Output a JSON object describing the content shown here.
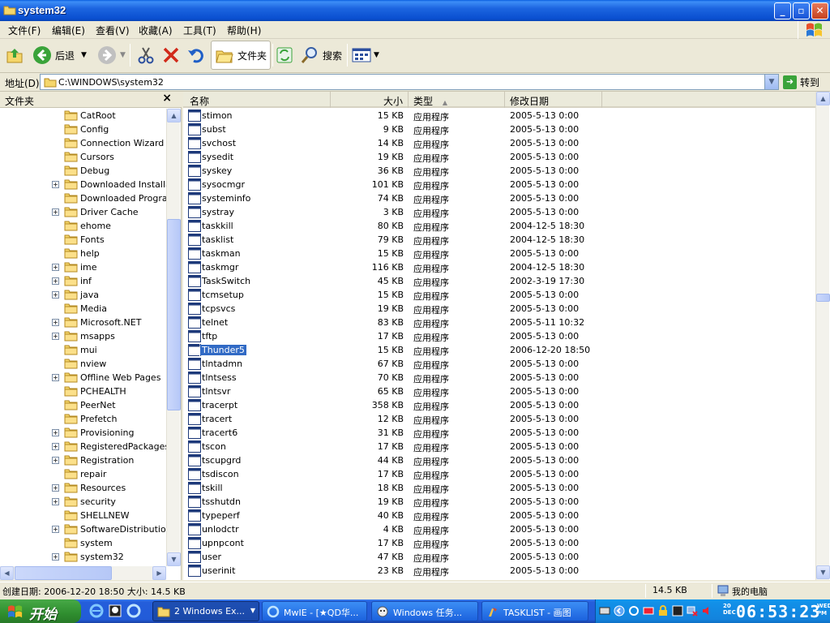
{
  "window": {
    "title": "system32"
  },
  "menu": [
    "文件(F)",
    "编辑(E)",
    "查看(V)",
    "收藏(A)",
    "工具(T)",
    "帮助(H)"
  ],
  "toolbar": {
    "back": "后退",
    "folders": "文件夹",
    "search": "搜索"
  },
  "address": {
    "label": "地址(D)",
    "value": "C:\\WINDOWS\\system32",
    "go": "转到"
  },
  "folder_pane": {
    "title": "文件夹",
    "close": "×",
    "items": [
      {
        "label": "CatRoot",
        "expandable": false
      },
      {
        "label": "Config",
        "expandable": false
      },
      {
        "label": "Connection Wizard",
        "expandable": false
      },
      {
        "label": "Cursors",
        "expandable": false
      },
      {
        "label": "Debug",
        "expandable": false
      },
      {
        "label": "Downloaded Installatio",
        "expandable": true
      },
      {
        "label": "Downloaded Program",
        "expandable": false
      },
      {
        "label": "Driver Cache",
        "expandable": true
      },
      {
        "label": "ehome",
        "expandable": false
      },
      {
        "label": "Fonts",
        "expandable": false
      },
      {
        "label": "help",
        "expandable": false
      },
      {
        "label": "ime",
        "expandable": true
      },
      {
        "label": "inf",
        "expandable": true
      },
      {
        "label": "java",
        "expandable": true
      },
      {
        "label": "Media",
        "expandable": false
      },
      {
        "label": "Microsoft.NET",
        "expandable": true
      },
      {
        "label": "msapps",
        "expandable": true
      },
      {
        "label": "mui",
        "expandable": false
      },
      {
        "label": "nview",
        "expandable": false
      },
      {
        "label": "Offline Web Pages",
        "expandable": true
      },
      {
        "label": "PCHEALTH",
        "expandable": false
      },
      {
        "label": "PeerNet",
        "expandable": false
      },
      {
        "label": "Prefetch",
        "expandable": false
      },
      {
        "label": "Provisioning",
        "expandable": true
      },
      {
        "label": "RegisteredPackages",
        "expandable": true
      },
      {
        "label": "Registration",
        "expandable": true
      },
      {
        "label": "repair",
        "expandable": false
      },
      {
        "label": "Resources",
        "expandable": true
      },
      {
        "label": "security",
        "expandable": true
      },
      {
        "label": "SHELLNEW",
        "expandable": false
      },
      {
        "label": "SoftwareDistribution",
        "expandable": true
      },
      {
        "label": "system",
        "expandable": false
      },
      {
        "label": "system32",
        "expandable": true
      }
    ]
  },
  "columns": {
    "name": "名称",
    "size": "大小",
    "type": "类型",
    "modified": "修改日期"
  },
  "files": [
    {
      "name": "stimon",
      "size": "15 KB",
      "type": "应用程序",
      "modified": "2005-5-13 0:00"
    },
    {
      "name": "subst",
      "size": "9 KB",
      "type": "应用程序",
      "modified": "2005-5-13 0:00"
    },
    {
      "name": "svchost",
      "size": "14 KB",
      "type": "应用程序",
      "modified": "2005-5-13 0:00"
    },
    {
      "name": "sysedit",
      "size": "19 KB",
      "type": "应用程序",
      "modified": "2005-5-13 0:00"
    },
    {
      "name": "syskey",
      "size": "36 KB",
      "type": "应用程序",
      "modified": "2005-5-13 0:00"
    },
    {
      "name": "sysocmgr",
      "size": "101 KB",
      "type": "应用程序",
      "modified": "2005-5-13 0:00"
    },
    {
      "name": "systeminfo",
      "size": "74 KB",
      "type": "应用程序",
      "modified": "2005-5-13 0:00"
    },
    {
      "name": "systray",
      "size": "3 KB",
      "type": "应用程序",
      "modified": "2005-5-13 0:00"
    },
    {
      "name": "taskkill",
      "size": "80 KB",
      "type": "应用程序",
      "modified": "2004-12-5 18:30"
    },
    {
      "name": "tasklist",
      "size": "79 KB",
      "type": "应用程序",
      "modified": "2004-12-5 18:30"
    },
    {
      "name": "taskman",
      "size": "15 KB",
      "type": "应用程序",
      "modified": "2005-5-13 0:00"
    },
    {
      "name": "taskmgr",
      "size": "116 KB",
      "type": "应用程序",
      "modified": "2004-12-5 18:30"
    },
    {
      "name": "TaskSwitch",
      "size": "45 KB",
      "type": "应用程序",
      "modified": "2002-3-19 17:30"
    },
    {
      "name": "tcmsetup",
      "size": "15 KB",
      "type": "应用程序",
      "modified": "2005-5-13 0:00"
    },
    {
      "name": "tcpsvcs",
      "size": "19 KB",
      "type": "应用程序",
      "modified": "2005-5-13 0:00"
    },
    {
      "name": "telnet",
      "size": "83 KB",
      "type": "应用程序",
      "modified": "2005-5-11 10:32"
    },
    {
      "name": "tftp",
      "size": "17 KB",
      "type": "应用程序",
      "modified": "2005-5-13 0:00"
    },
    {
      "name": "Thunder5",
      "size": "15 KB",
      "type": "应用程序",
      "modified": "2006-12-20 18:50",
      "selected": true
    },
    {
      "name": "tlntadmn",
      "size": "67 KB",
      "type": "应用程序",
      "modified": "2005-5-13 0:00"
    },
    {
      "name": "tlntsess",
      "size": "70 KB",
      "type": "应用程序",
      "modified": "2005-5-13 0:00"
    },
    {
      "name": "tlntsvr",
      "size": "65 KB",
      "type": "应用程序",
      "modified": "2005-5-13 0:00"
    },
    {
      "name": "tracerpt",
      "size": "358 KB",
      "type": "应用程序",
      "modified": "2005-5-13 0:00"
    },
    {
      "name": "tracert",
      "size": "12 KB",
      "type": "应用程序",
      "modified": "2005-5-13 0:00"
    },
    {
      "name": "tracert6",
      "size": "31 KB",
      "type": "应用程序",
      "modified": "2005-5-13 0:00"
    },
    {
      "name": "tscon",
      "size": "17 KB",
      "type": "应用程序",
      "modified": "2005-5-13 0:00"
    },
    {
      "name": "tscupgrd",
      "size": "44 KB",
      "type": "应用程序",
      "modified": "2005-5-13 0:00"
    },
    {
      "name": "tsdiscon",
      "size": "17 KB",
      "type": "应用程序",
      "modified": "2005-5-13 0:00"
    },
    {
      "name": "tskill",
      "size": "18 KB",
      "type": "应用程序",
      "modified": "2005-5-13 0:00"
    },
    {
      "name": "tsshutdn",
      "size": "19 KB",
      "type": "应用程序",
      "modified": "2005-5-13 0:00"
    },
    {
      "name": "typeperf",
      "size": "40 KB",
      "type": "应用程序",
      "modified": "2005-5-13 0:00"
    },
    {
      "name": "unlodctr",
      "size": "4 KB",
      "type": "应用程序",
      "modified": "2005-5-13 0:00"
    },
    {
      "name": "upnpcont",
      "size": "17 KB",
      "type": "应用程序",
      "modified": "2005-5-13 0:00"
    },
    {
      "name": "user",
      "size": "47 KB",
      "type": "应用程序",
      "modified": "2005-5-13 0:00"
    },
    {
      "name": "userinit",
      "size": "23 KB",
      "type": "应用程序",
      "modified": "2005-5-13 0:00"
    }
  ],
  "status": {
    "info": "创建日期: 2006-12-20 18:50 大小: 14.5 KB",
    "size": "14.5 KB",
    "location": "我的电脑"
  },
  "taskbar": {
    "start": "开始",
    "tasks": [
      {
        "label": "2 Windows Ex...",
        "active": true
      },
      {
        "label": "MwIE - [★QD华...",
        "active": false
      },
      {
        "label": "Windows 任务...",
        "active": false
      },
      {
        "label": "TASKLIST - 画图",
        "active": false
      }
    ],
    "clock": {
      "day": "20",
      "month": "DEC",
      "time": "06:53:23",
      "ampm_top": "WED",
      "ampm_bottom": "PM"
    }
  },
  "colors": {
    "selection": "#316ac5",
    "titlebar": "#0a5ee0",
    "taskbar": "#245edb",
    "start": "#2f8e2f"
  }
}
